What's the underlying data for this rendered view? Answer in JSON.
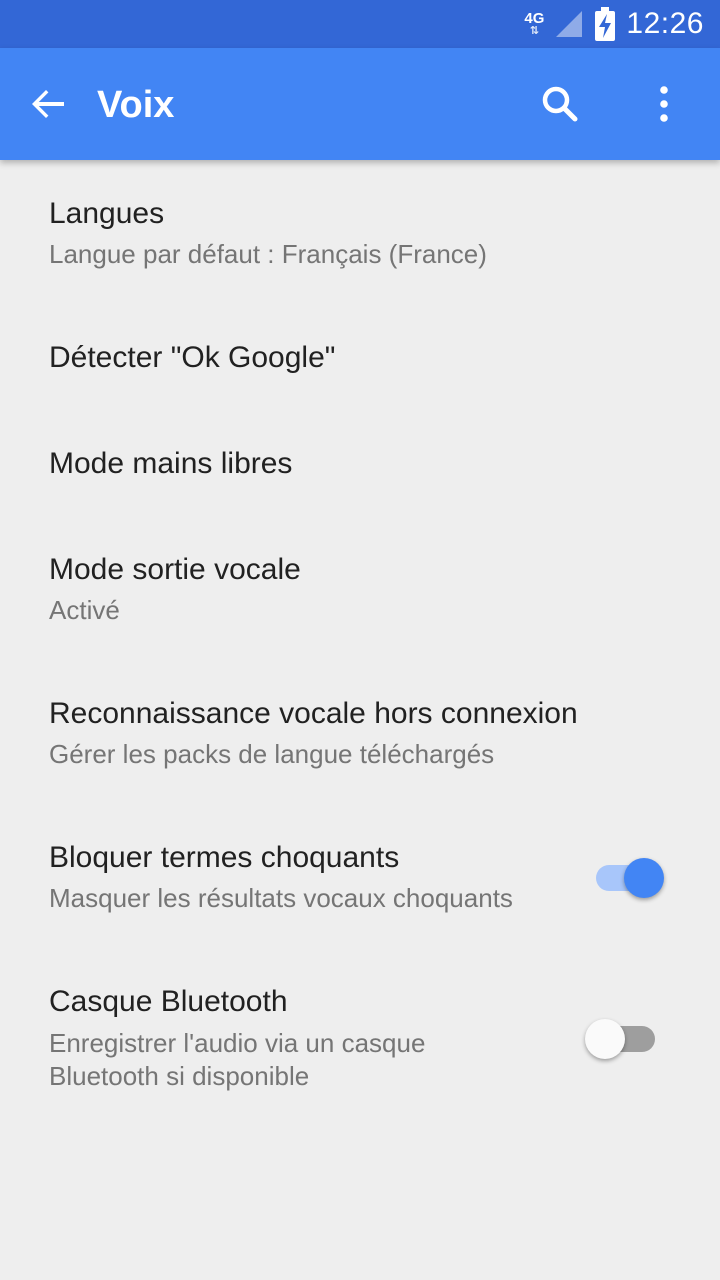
{
  "status_bar": {
    "network": "4G",
    "network_arrows": "⇅",
    "time": "12:26"
  },
  "app_bar": {
    "title": "Voix"
  },
  "settings": [
    {
      "title": "Langues",
      "summary": "Langue par défaut : Français (France)"
    },
    {
      "title": "Détecter \"Ok Google\""
    },
    {
      "title": "Mode mains libres"
    },
    {
      "title": "Mode sortie vocale",
      "summary": "Activé"
    },
    {
      "title": "Reconnaissance vocale hors connexion",
      "summary": "Gérer les packs de langue téléchargés"
    },
    {
      "title": "Bloquer termes choquants",
      "summary": "Masquer les résultats vocaux choquants",
      "enabled": true
    },
    {
      "title": "Casque Bluetooth",
      "summary_line1": "Enregistrer l'audio via un casque",
      "summary_line2": "Bluetooth si disponible",
      "enabled": false
    }
  ],
  "colors": {
    "primary": "#4285f4",
    "primary_dark": "#3367d6",
    "switch_on": "#4285f4",
    "switch_off": "#9e9e9e"
  },
  "icons": [
    "back-arrow-icon",
    "search-icon",
    "more-vert-icon",
    "signal-icon",
    "battery-charging-icon"
  ]
}
